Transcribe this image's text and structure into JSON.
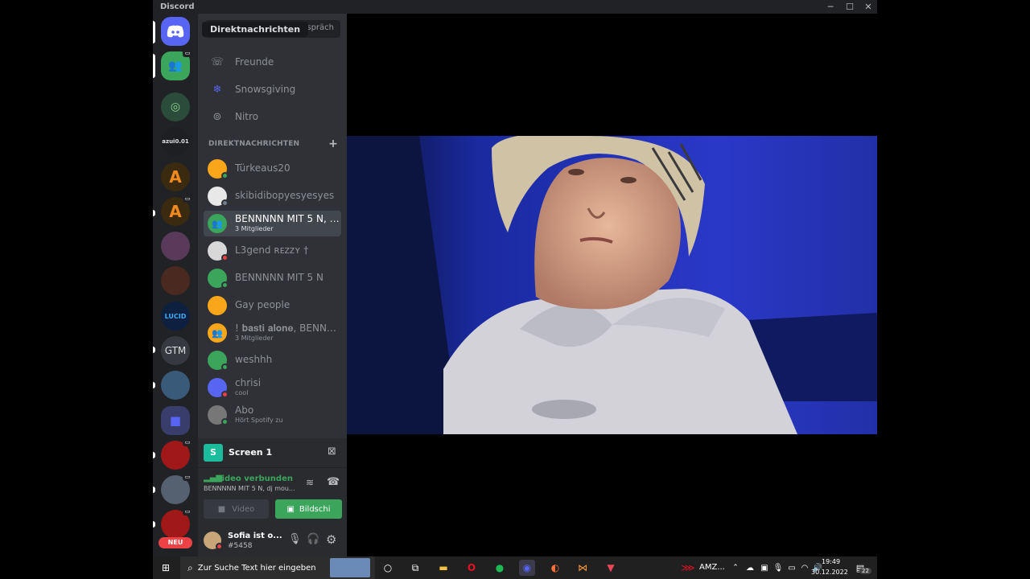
{
  "window": {
    "title": "Discord",
    "minimize": "─",
    "maximize": "☐",
    "close": "✕"
  },
  "guilds": [
    {
      "label": "",
      "color": "#5865f2",
      "icon": "discord-icon"
    },
    {
      "label": "",
      "color": "#3ba55c",
      "icon": "group-icon"
    },
    {
      "label": "",
      "color": "#2c4c3b",
      "icon": "server-icon"
    },
    {
      "label": "azui0.01",
      "color": "#1e1f22"
    },
    {
      "label": "A",
      "color": "#3a2a10"
    },
    {
      "label": "A",
      "color": "#3a2a10"
    },
    {
      "label": "",
      "color": "#5a3a5a"
    },
    {
      "label": "",
      "color": "#4a2a20"
    },
    {
      "label": "LUCID",
      "color": "#0d2040"
    },
    {
      "label": "GTM",
      "color": "#36393f"
    },
    {
      "label": "",
      "color": "#3a5a7a"
    },
    {
      "label": "",
      "color": "#5865f2",
      "icon": "folder-icon"
    },
    {
      "label": "",
      "color": "#a01818"
    },
    {
      "label": "",
      "color": "#556070"
    },
    {
      "label": "",
      "color": "#a01818"
    }
  ],
  "new_badge": "NEU",
  "search": {
    "placeholder": "Gespräch",
    "tooltip": "Direktnachrichten"
  },
  "nav": [
    {
      "label": "Freunde",
      "icon": "friends-icon"
    },
    {
      "label": "Snowsgiving",
      "icon": "snowflake-icon"
    },
    {
      "label": "Nitro",
      "icon": "nitro-icon"
    }
  ],
  "dm_header": "DIREKTNACHRICHTEN",
  "dms": [
    {
      "name": "Türkeaus20",
      "sub": "",
      "color": "#faa61a",
      "status": "#3ba55c"
    },
    {
      "name": "skibidibopyesyesyes",
      "sub": "",
      "color": "#e8e8e8",
      "status": "#747f8d"
    },
    {
      "name": "BENNNNN MIT 5 N, dj...",
      "sub": "3 Mitglieder",
      "color": "#3ba55c",
      "status": ""
    },
    {
      "name": "L3gend ʀᴇᴢᴢʏ †",
      "sub": "",
      "color": "#d8d8d8",
      "status": "#ed4245"
    },
    {
      "name": "BENNNNN MIT 5 N",
      "sub": "",
      "color": "#3ba55c",
      "status": "#3ba55c"
    },
    {
      "name": "Gay people",
      "sub": "",
      "color": "#faa61a",
      "status": ""
    },
    {
      "name": "! 𝐛𝐚𝐬𝐭𝐢 𝐚𝐥𝐨𝐧𝐞, BENNN...",
      "sub": "3 Mitglieder",
      "color": "#faa61a",
      "status": ""
    },
    {
      "name": "weshhh",
      "sub": "",
      "color": "#3ba55c",
      "status": "#3ba55c"
    },
    {
      "name": "chrisi",
      "sub": "cool",
      "color": "#5865f2",
      "status": "#ed4245"
    },
    {
      "name": "Abo",
      "sub": "Hört Spotify zu",
      "color": "#777777",
      "status": "#3ba55c"
    }
  ],
  "stream": {
    "label": "Screen 1",
    "avatar_letter": "S"
  },
  "voice": {
    "status": "Video verbunden",
    "channel": "BENNNNN MIT 5 N, dj mou...",
    "video_label": "Video",
    "screen_label": "Bildschi"
  },
  "user": {
    "name": "Sofia ist o...",
    "tag": "#5458"
  },
  "taskbar": {
    "search_placeholder": "Zur Suche Text hier eingeben",
    "tray_label": "AMZ...",
    "time": "19:49",
    "date": "30.12.2022",
    "notifications": "22"
  }
}
